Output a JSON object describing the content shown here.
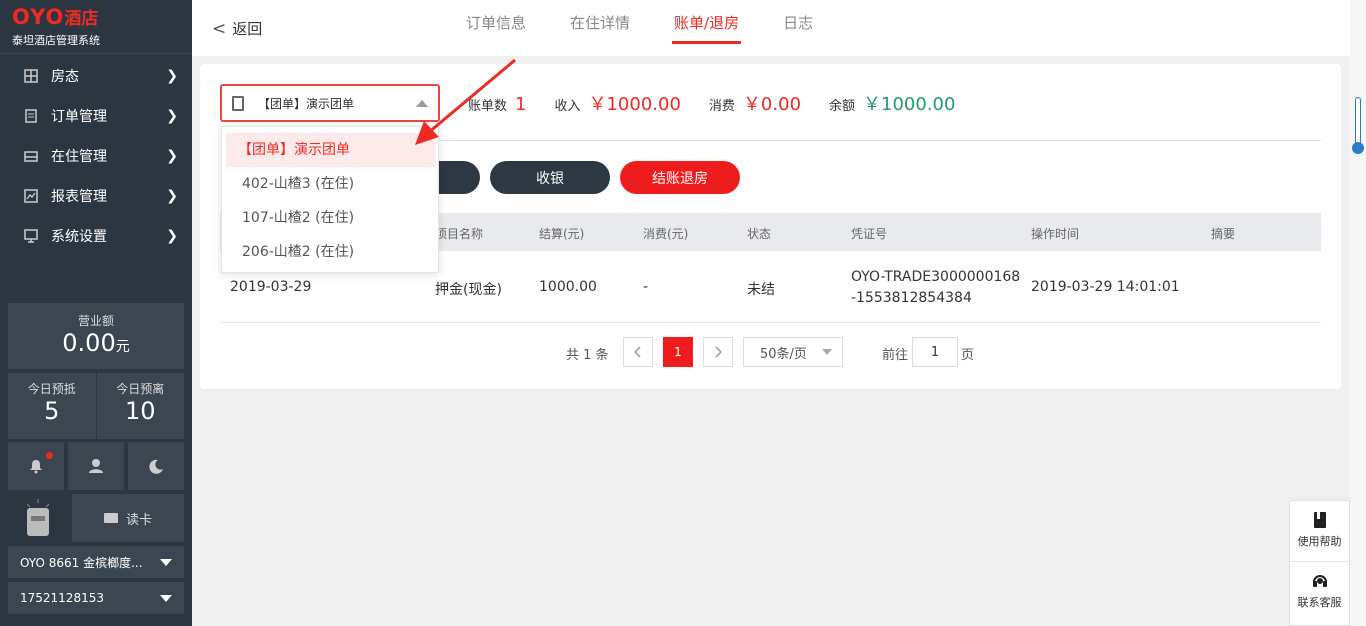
{
  "brand": {
    "logo": "OYO",
    "logo_cn": "酒店",
    "subtitle": "泰坦酒店管理系统"
  },
  "nav": [
    {
      "label": "房态",
      "icon": "grid-icon"
    },
    {
      "label": "订单管理",
      "icon": "list-icon"
    },
    {
      "label": "在住管理",
      "icon": "bed-icon"
    },
    {
      "label": "报表管理",
      "icon": "chart-icon"
    },
    {
      "label": "系统设置",
      "icon": "settings-icon"
    }
  ],
  "stats": {
    "revenue_label": "营业额",
    "revenue_value": "0.00",
    "revenue_unit": "元",
    "arrive_label": "今日预抵",
    "arrive_value": "5",
    "depart_label": "今日预离",
    "depart_value": "10"
  },
  "read_card": "读卡",
  "hotel_select": "OYO 8661 金槟榔度...",
  "phone_select": "17521128153",
  "header": {
    "back": "返回",
    "tabs": [
      "订单信息",
      "在住详情",
      "账单/退房",
      "日志"
    ],
    "active_tab": 2
  },
  "bill": {
    "selected": "【团单】演示团单",
    "count_label": "账单数",
    "count": "1",
    "income_label": "收入",
    "income": "￥1000.00",
    "consume_label": "消费",
    "consume": "￥0.00",
    "balance_label": "余额",
    "balance": "￥1000.00"
  },
  "buttons": {
    "cashier": "收银",
    "checkout": "结账退房"
  },
  "dropdown": [
    "【团单】演示团单",
    "402-山楂3 (在住)",
    "107-山楂2 (在住)",
    "206-山楂2 (在住)"
  ],
  "table": {
    "headers": [
      "项目名称",
      "结算(元)",
      "消费(元)",
      "状态",
      "凭证号",
      "操作时间",
      "摘要"
    ],
    "rows": [
      {
        "date": "2019-03-29",
        "item": "押金(现金)",
        "settle": "1000.00",
        "consume": "-",
        "status": "未结",
        "voucher": "OYO-TRADE3000000168-1553812854384",
        "time": "2019-03-29 14:01:01",
        "note": ""
      }
    ]
  },
  "pager": {
    "total": "共 1 条",
    "current": "1",
    "size": "50条/页",
    "goto": "前往",
    "goto_value": "1",
    "unit": "页"
  },
  "help": {
    "manual": "使用帮助",
    "support": "联系客服"
  },
  "colors": {
    "accent": "#ee2a24",
    "sidebar": "#2c3640",
    "positive": "#1f9d6b"
  }
}
